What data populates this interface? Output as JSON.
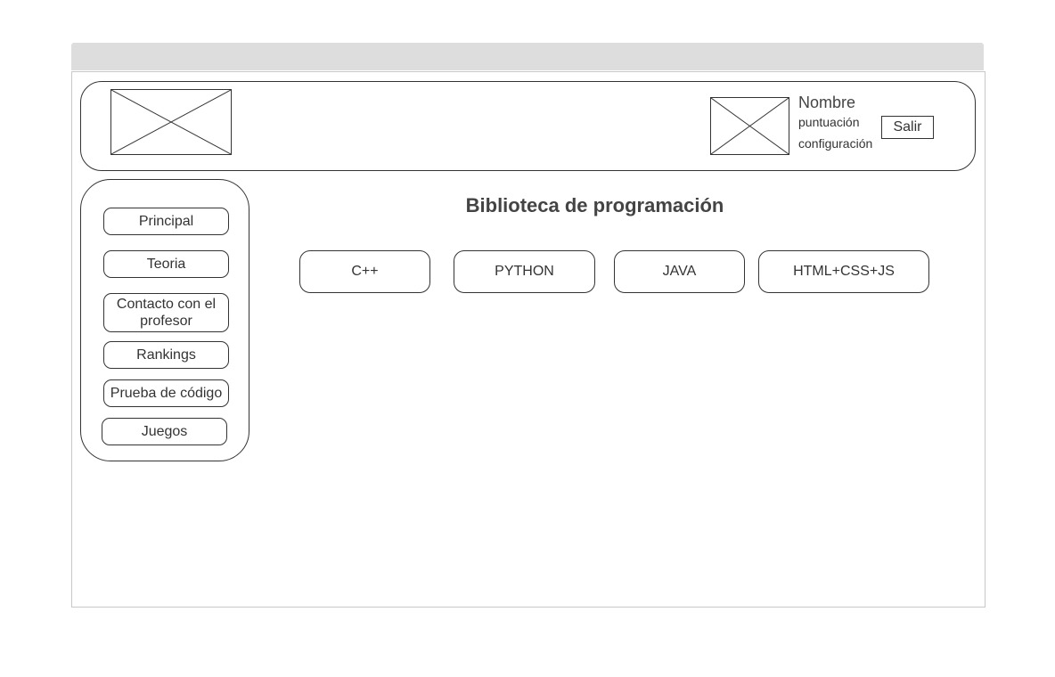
{
  "header": {
    "user": {
      "name": "Nombre",
      "score_label": "puntuación",
      "settings_label": "configuración",
      "logout_label": "Salir"
    }
  },
  "sidebar": {
    "items": [
      {
        "label": "Principal"
      },
      {
        "label": "Teoria"
      },
      {
        "label": "Contacto con el profesor"
      },
      {
        "label": "Rankings"
      },
      {
        "label": "Prueba de código"
      },
      {
        "label": "Juegos"
      }
    ]
  },
  "main": {
    "title": "Biblioteca de programación",
    "languages": [
      {
        "label": "C++"
      },
      {
        "label": "PYTHON"
      },
      {
        "label": "JAVA"
      },
      {
        "label": "HTML+CSS+JS"
      }
    ]
  }
}
